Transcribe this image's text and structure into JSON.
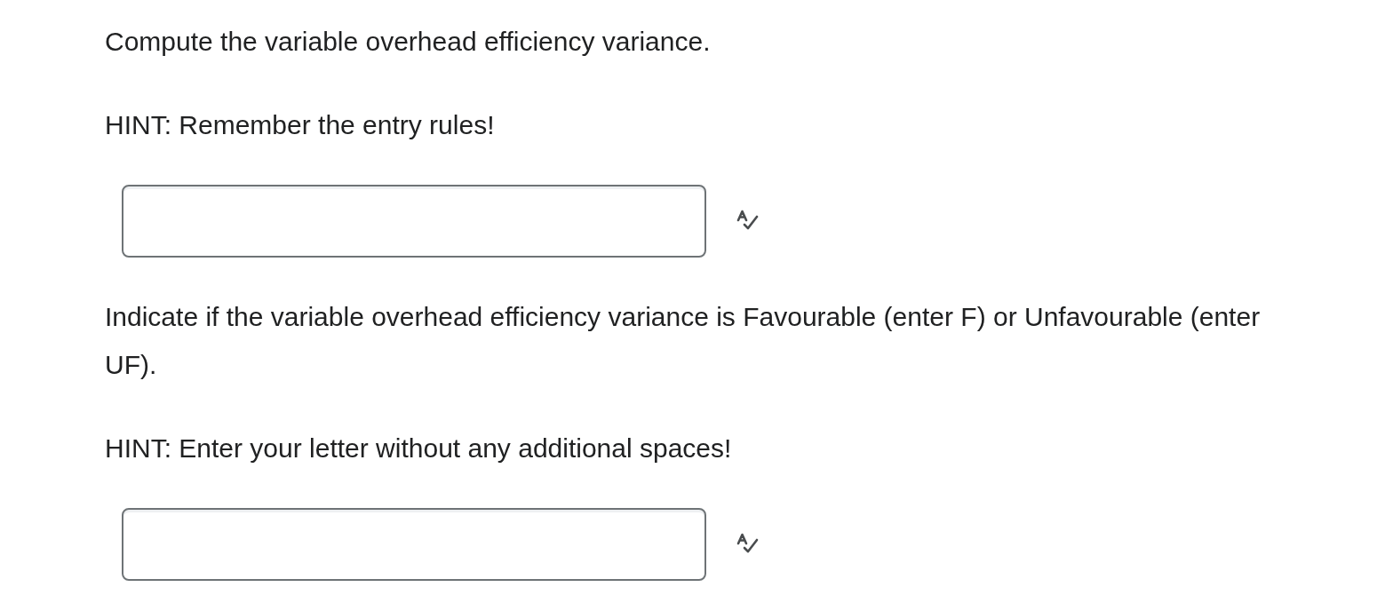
{
  "items": [
    {
      "kind": "text",
      "text": "Compute the variable overhead efficiency variance."
    },
    {
      "kind": "text",
      "text": "HINT: Remember the entry rules!"
    },
    {
      "kind": "answer"
    },
    {
      "kind": "text",
      "text": "Indicate if the variable overhead efficiency variance is Favourable (enter F) or Unfavourable (enter UF)."
    },
    {
      "kind": "text",
      "text": "HINT: Enter your letter without any additional spaces!"
    },
    {
      "kind": "answer"
    }
  ]
}
